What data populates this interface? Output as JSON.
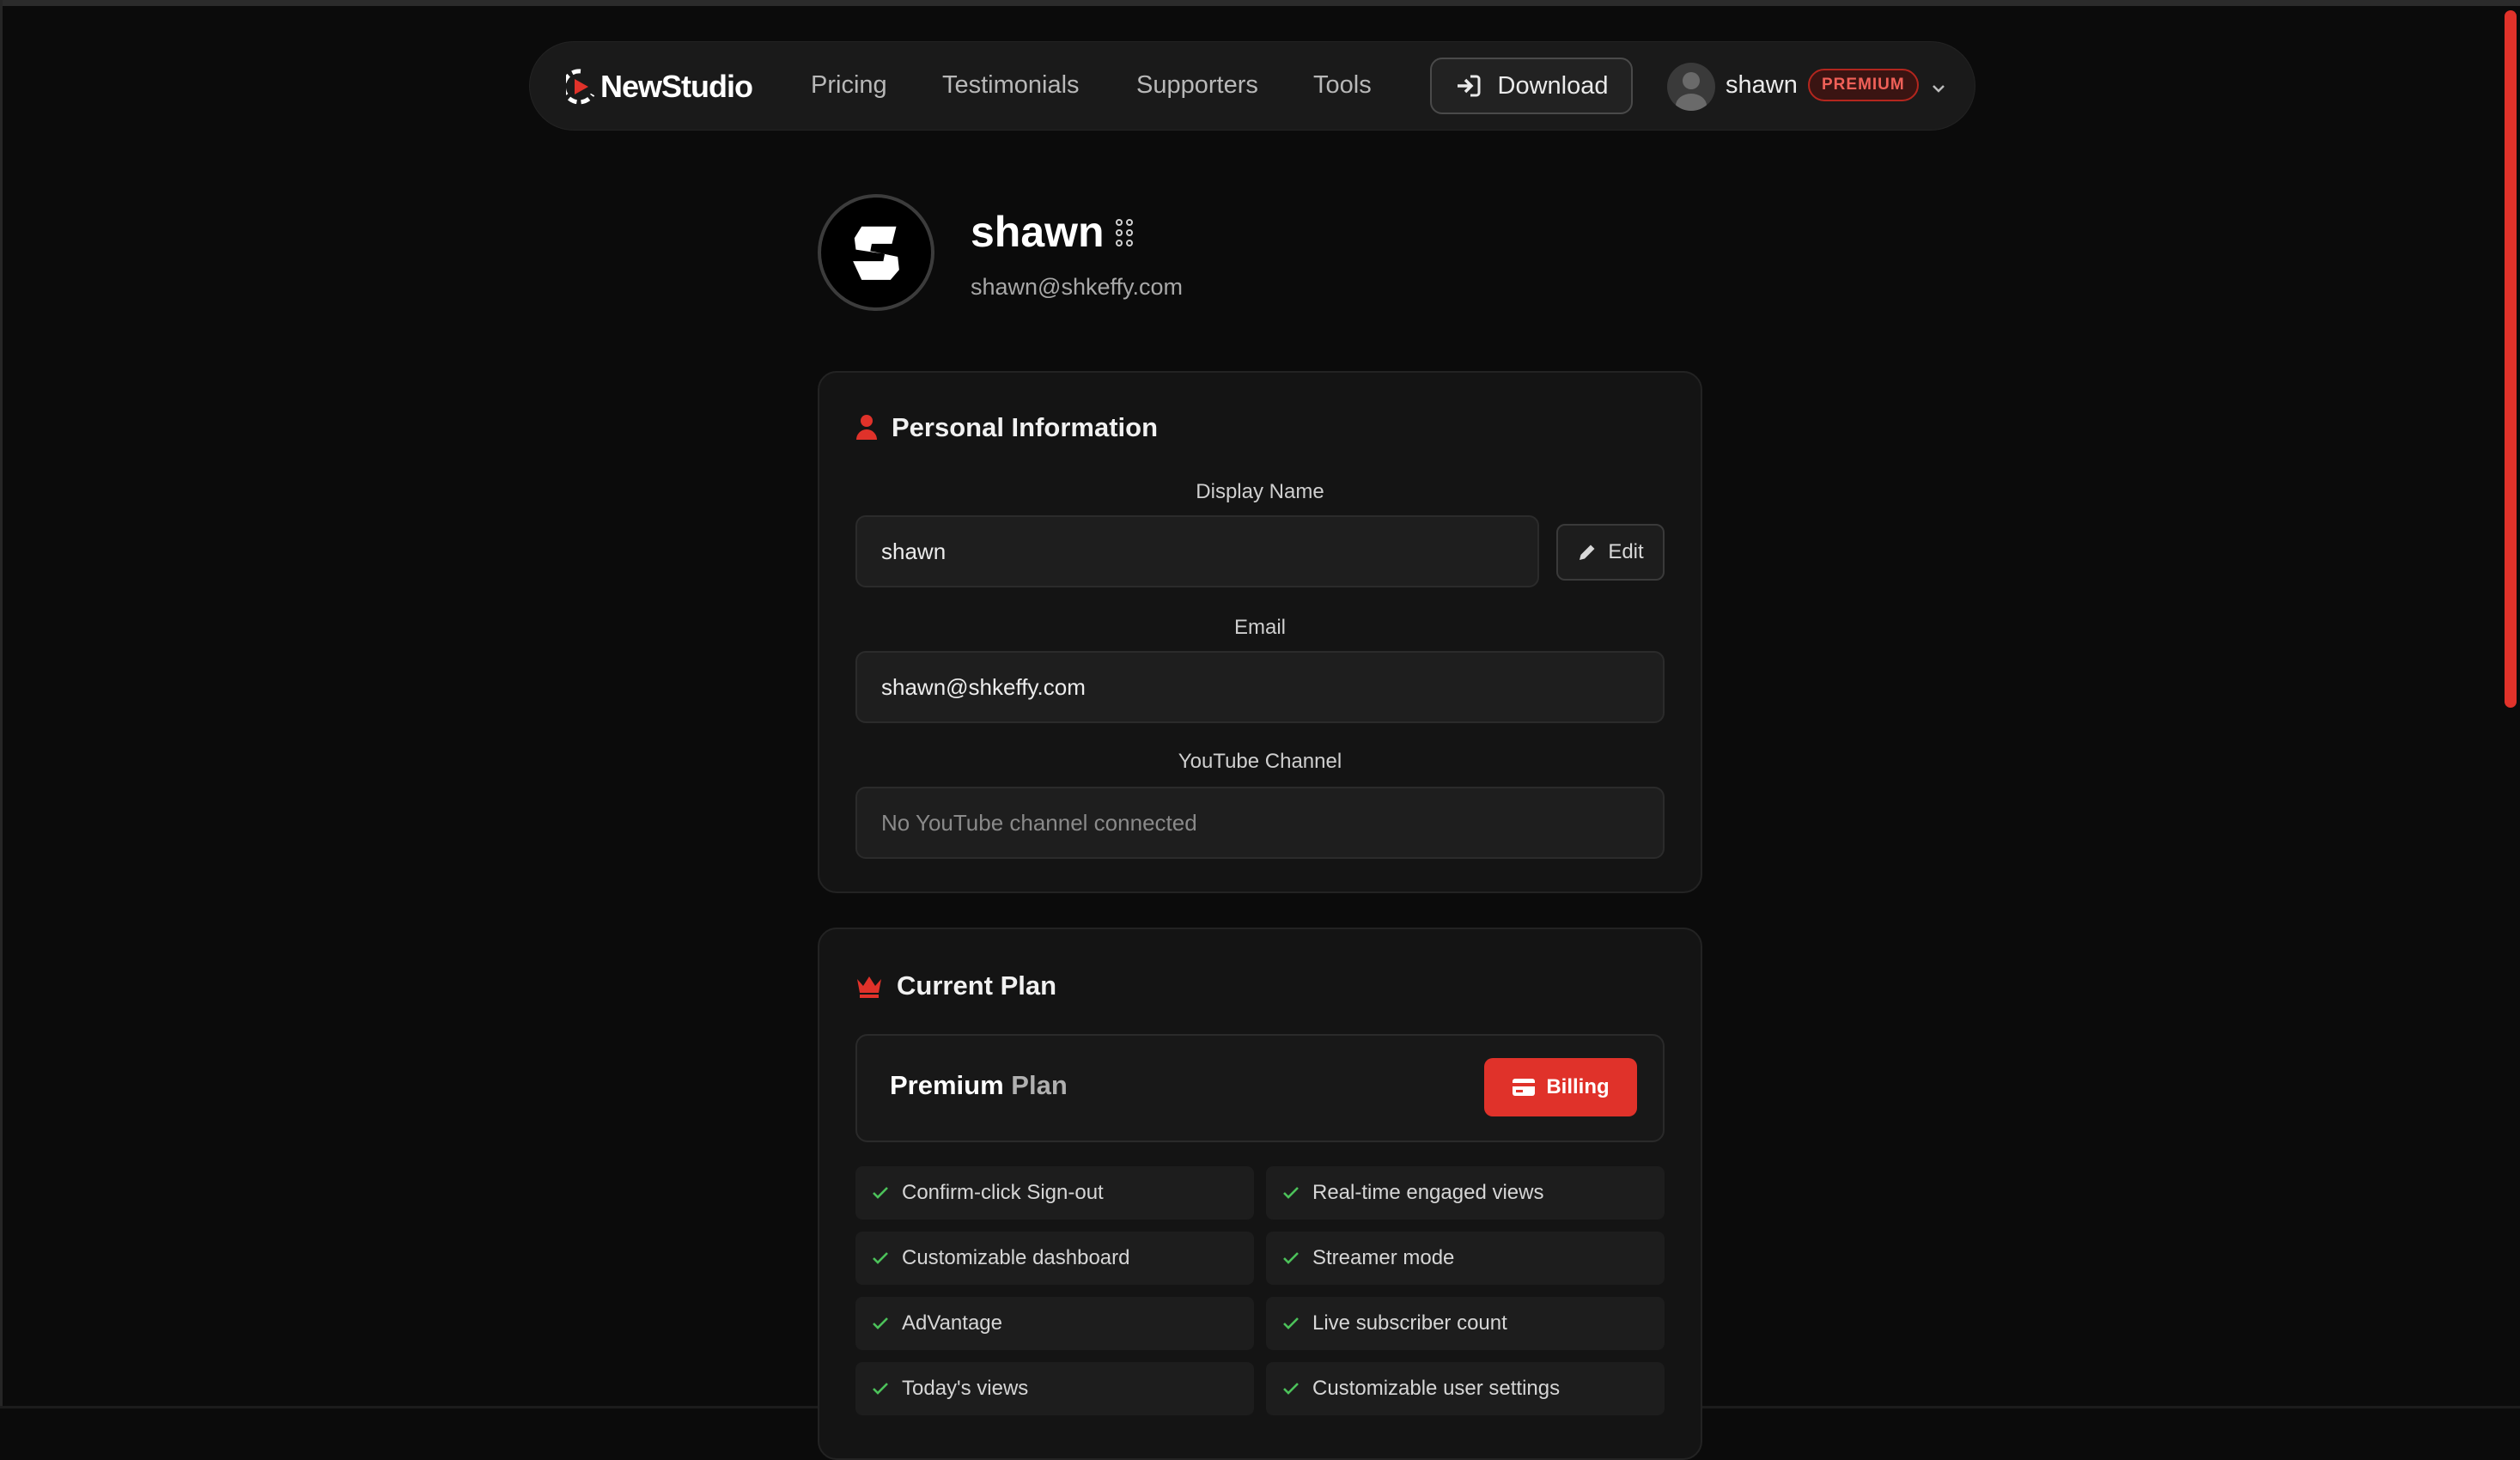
{
  "brand": {
    "name": "NewStudio",
    "accent": "#e0322a"
  },
  "nav": {
    "links": [
      "Pricing",
      "Testimonials",
      "Supporters",
      "Tools"
    ],
    "download_label": "Download",
    "user_name": "shawn",
    "badge": "PREMIUM"
  },
  "profile": {
    "avatar_letter": "S",
    "name": "shawn",
    "email": "shawn@shkeffy.com"
  },
  "personal_info": {
    "title": "Personal Information",
    "display_name_label": "Display Name",
    "display_name_value": "shawn",
    "edit_label": "Edit",
    "email_label": "Email",
    "email_value": "shawn@shkeffy.com",
    "youtube_label": "YouTube Channel",
    "youtube_placeholder": "No YouTube channel connected"
  },
  "current_plan": {
    "title": "Current Plan",
    "plan_word1": "Premium",
    "plan_word2": "Plan",
    "billing_label": "Billing",
    "features": [
      "Confirm-click Sign-out",
      "Real-time engaged views",
      "Customizable dashboard",
      "Streamer mode",
      "AdVantage",
      "Live subscriber count",
      "Today's views",
      "Customizable user settings"
    ]
  }
}
